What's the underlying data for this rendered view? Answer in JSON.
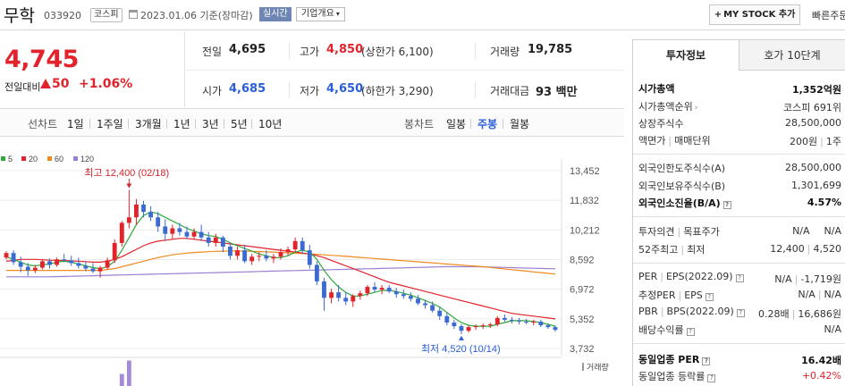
{
  "header": {
    "stock_name": "무학",
    "stock_code": "033920",
    "market_badge": "코스피",
    "date_text": "2023.01.06 기준(장마감)",
    "realtime_label": "실시간",
    "company_btn_label": "기업개요",
    "company_btn_chevron": "▾",
    "mystock_plus": "+",
    "mystock_label": "MY STOCK 추가",
    "quick_link": "빠른주문"
  },
  "price": {
    "current": "4,745",
    "change_label": "전일대비",
    "change_amount": "50",
    "change_rate": "+1.06%"
  },
  "quote": {
    "prev_label": "전일",
    "prev_value": "4,695",
    "high_label": "고가",
    "high_value": "4,850",
    "high_limit": "(상한가 6,100)",
    "volume_label": "거래량",
    "volume_value": "19,785",
    "open_label": "시가",
    "open_value": "4,685",
    "low_label": "저가",
    "low_value": "4,650",
    "low_limit": "(하한가 3,290)",
    "amount_label": "거래대금",
    "amount_value": "93 백만"
  },
  "periods": {
    "line_label": "선차트",
    "line_tabs": [
      "1일",
      "1주일",
      "3개월",
      "1년",
      "3년",
      "5년",
      "10년"
    ],
    "candle_label": "봉차트",
    "candle_tabs": [
      "일봉",
      "주봉",
      "월봉"
    ],
    "candle_selected": 1
  },
  "chart_data": {
    "type": "candlestick",
    "ma_legend": [
      {
        "label": "5",
        "color": "#2fa83a"
      },
      {
        "label": "20",
        "color": "#e2232b"
      },
      {
        "label": "60",
        "color": "#f08a1c"
      },
      {
        "label": "120",
        "color": "#9b7fd0"
      }
    ],
    "y_ticks": [
      "13,452",
      "11,832",
      "10,212",
      "8,592",
      "6,972",
      "5,352",
      "3,732"
    ],
    "y_tick_values": [
      13452,
      11832,
      10212,
      8592,
      6972,
      5352,
      3732
    ],
    "ylim": [
      3732,
      13452
    ],
    "annotation_high": "최고 12,400 (02/18)",
    "annotation_low": "최저 4,520 (10/14)",
    "high_marker": {
      "index": 17,
      "value": 12400
    },
    "low_marker": {
      "index": 63,
      "value": 4520
    },
    "up_color": "#e2232b",
    "down_color": "#3b6bd1",
    "volume_label": "거래량",
    "candles": [
      [
        8700,
        9050,
        8600,
        8950
      ],
      [
        8950,
        9100,
        8300,
        8450
      ],
      [
        8450,
        8750,
        7900,
        8200
      ],
      [
        8200,
        8400,
        7700,
        8000
      ],
      [
        8000,
        8300,
        7850,
        8150
      ],
      [
        8150,
        8600,
        8050,
        8500
      ],
      [
        8500,
        8650,
        8100,
        8300
      ],
      [
        8300,
        8700,
        8200,
        8600
      ],
      [
        8600,
        8900,
        8450,
        8550
      ],
      [
        8550,
        8800,
        8250,
        8400
      ],
      [
        8400,
        8700,
        8100,
        8250
      ],
      [
        8250,
        8500,
        7950,
        8100
      ],
      [
        8100,
        8400,
        7850,
        7950
      ],
      [
        7950,
        8250,
        7600,
        8150
      ],
      [
        8150,
        8700,
        8050,
        8550
      ],
      [
        8550,
        9700,
        8400,
        9500
      ],
      [
        9500,
        10700,
        9300,
        10600
      ],
      [
        10600,
        12400,
        10300,
        10900
      ],
      [
        10900,
        11900,
        10500,
        11600
      ],
      [
        11600,
        11800,
        10900,
        11200
      ],
      [
        11200,
        11500,
        10700,
        10900
      ],
      [
        10900,
        11200,
        10100,
        10400
      ],
      [
        10400,
        10800,
        9600,
        10000
      ],
      [
        10000,
        10500,
        9700,
        10300
      ],
      [
        10300,
        10600,
        9900,
        10100
      ],
      [
        10100,
        10400,
        9700,
        9850
      ],
      [
        9850,
        10300,
        9700,
        10100
      ],
      [
        10100,
        10500,
        9600,
        9800
      ],
      [
        9800,
        10100,
        9300,
        9500
      ],
      [
        9500,
        10000,
        9300,
        9800
      ],
      [
        9800,
        9900,
        9000,
        9300
      ],
      [
        9300,
        9500,
        8600,
        8800
      ],
      [
        8800,
        9300,
        8600,
        9100
      ],
      [
        9100,
        9400,
        8400,
        8500
      ],
      [
        8500,
        8900,
        8300,
        8750
      ],
      [
        8750,
        9000,
        8500,
        8800
      ],
      [
        8800,
        9100,
        8500,
        8650
      ],
      [
        8650,
        8900,
        8400,
        8750
      ],
      [
        8750,
        9200,
        8600,
        9000
      ],
      [
        9000,
        9300,
        8800,
        9150
      ],
      [
        9150,
        9800,
        9000,
        9600
      ],
      [
        9600,
        9800,
        8900,
        9100
      ],
      [
        9100,
        9400,
        8100,
        8300
      ],
      [
        8300,
        8500,
        7200,
        7400
      ],
      [
        7400,
        7600,
        5800,
        6500
      ],
      [
        6500,
        7000,
        6200,
        6800
      ],
      [
        6800,
        7200,
        6300,
        6500
      ],
      [
        6500,
        6800,
        6100,
        6300
      ],
      [
        6300,
        6700,
        6000,
        6600
      ],
      [
        6600,
        6900,
        6400,
        6750
      ],
      [
        6750,
        7200,
        6600,
        7100
      ],
      [
        7100,
        7350,
        6800,
        6950
      ],
      [
        6950,
        7200,
        6700,
        7050
      ],
      [
        7050,
        7200,
        6750,
        6850
      ],
      [
        6850,
        7050,
        6500,
        6700
      ],
      [
        6700,
        6950,
        6450,
        6600
      ],
      [
        6600,
        6800,
        6300,
        6450
      ],
      [
        6450,
        6650,
        6100,
        6200
      ],
      [
        6200,
        6400,
        5900,
        6100
      ],
      [
        6100,
        6300,
        5700,
        5800
      ],
      [
        5800,
        6000,
        5300,
        5500
      ],
      [
        5500,
        5700,
        5000,
        5150
      ],
      [
        5150,
        5300,
        4800,
        4950
      ],
      [
        4950,
        5050,
        4520,
        4700
      ],
      [
        4700,
        5000,
        4600,
        4900
      ],
      [
        4900,
        5050,
        4750,
        4950
      ],
      [
        4950,
        5100,
        4800,
        5000
      ],
      [
        5000,
        5150,
        4850,
        5050
      ],
      [
        5050,
        5500,
        4950,
        5400
      ],
      [
        5400,
        5600,
        5200,
        5300
      ],
      [
        5300,
        5450,
        5100,
        5250
      ],
      [
        5250,
        5400,
        5050,
        5200
      ],
      [
        5200,
        5350,
        5050,
        5150
      ],
      [
        5150,
        5300,
        5000,
        5200
      ],
      [
        5200,
        5300,
        4900,
        5000
      ],
      [
        5000,
        5100,
        4800,
        4900
      ],
      [
        4900,
        5000,
        4650,
        4750
      ]
    ],
    "ma5": [
      8750,
      8600,
      8450,
      8300,
      8250,
      8300,
      8350,
      8450,
      8500,
      8450,
      8350,
      8250,
      8150,
      8100,
      8200,
      8500,
      9100,
      9800,
      10500,
      11000,
      11200,
      11100,
      10900,
      10700,
      10500,
      10300,
      10150,
      10000,
      9900,
      9850,
      9700,
      9500,
      9350,
      9200,
      9050,
      8900,
      8800,
      8700,
      8700,
      8800,
      9000,
      9100,
      9000,
      8600,
      8000,
      7500,
      7100,
      6800,
      6600,
      6600,
      6700,
      6800,
      6900,
      6900,
      6850,
      6750,
      6650,
      6500,
      6350,
      6200,
      6000,
      5700,
      5400,
      5150,
      5000,
      4950,
      4950,
      4950,
      5050,
      5150,
      5250,
      5250,
      5250,
      5200,
      5150,
      5050,
      4950
    ],
    "ma20": [
      8500,
      8550,
      8600,
      8600,
      8600,
      8580,
      8560,
      8550,
      8540,
      8520,
      8500,
      8480,
      8450,
      8450,
      8500,
      8600,
      8750,
      8950,
      9150,
      9350,
      9500,
      9600,
      9650,
      9700,
      9750,
      9750,
      9700,
      9650,
      9600,
      9550,
      9500,
      9450,
      9400,
      9350,
      9300,
      9250,
      9200,
      9150,
      9100,
      9050,
      9000,
      8950,
      8900,
      8800,
      8700,
      8550,
      8400,
      8250,
      8100,
      7950,
      7800,
      7650,
      7500,
      7350,
      7250,
      7150,
      7050,
      6950,
      6850,
      6750,
      6650,
      6550,
      6450,
      6350,
      6250,
      6150,
      6050,
      5950,
      5850,
      5750,
      5650,
      5600,
      5550,
      5500,
      5450,
      5400,
      5350
    ],
    "ma60": [
      8000,
      8000,
      8000,
      8000,
      8000,
      8000,
      8000,
      8000,
      8000,
      8000,
      8000,
      8000,
      8000,
      8000,
      8050,
      8100,
      8200,
      8300,
      8400,
      8500,
      8600,
      8700,
      8780,
      8850,
      8900,
      8950,
      8980,
      9000,
      9020,
      9040,
      9050,
      9060,
      9060,
      9050,
      9040,
      9030,
      9010,
      9000,
      8980,
      8960,
      8940,
      8920,
      8900,
      8880,
      8850,
      8820,
      8800,
      8770,
      8740,
      8710,
      8680,
      8650,
      8620,
      8590,
      8560,
      8530,
      8500,
      8470,
      8440,
      8410,
      8380,
      8350,
      8320,
      8290,
      8260,
      8230,
      8200,
      8160,
      8120,
      8080,
      8040,
      8000,
      7960,
      7920,
      7880,
      7840,
      7800
    ],
    "ma120": [
      7650,
      7650,
      7650,
      7650,
      7650,
      7650,
      7650,
      7660,
      7670,
      7680,
      7690,
      7700,
      7710,
      7720,
      7730,
      7740,
      7750,
      7760,
      7770,
      7780,
      7790,
      7800,
      7810,
      7820,
      7830,
      7840,
      7850,
      7860,
      7870,
      7880,
      7890,
      7900,
      7910,
      7920,
      7930,
      7940,
      7950,
      7960,
      7970,
      7980,
      7990,
      8000,
      8010,
      8020,
      8030,
      8040,
      8050,
      8060,
      8070,
      8080,
      8090,
      8100,
      8110,
      8120,
      8130,
      8140,
      8150,
      8160,
      8170,
      8180,
      8190,
      8200,
      8200,
      8200,
      8200,
      8200,
      8190,
      8180,
      8170,
      8160,
      8150,
      8140,
      8130,
      8120,
      8110,
      8100,
      8090
    ],
    "volume_visible": [
      {
        "index": 17,
        "ratio": 0.95
      },
      {
        "index": 16,
        "ratio": 0.45
      }
    ]
  },
  "right_panel": {
    "tab_invest": "투자정보",
    "tab_hoga": "호가 10단계",
    "market_cap_label": "시가총액",
    "market_cap_value": "1,352억원",
    "cap_rank_label": "시가총액순위",
    "cap_rank_value": "코스피 691위",
    "shares_label": "상장주식수",
    "shares_value": "28,500,000",
    "par_label": "액면가",
    "unit_label": "매매단위",
    "par_value": "200원",
    "unit_value": "1주",
    "foreign_limit_label": "외국인한도주식수(A)",
    "foreign_limit_value": "28,500,000",
    "foreign_hold_label": "외국인보유주식수(B)",
    "foreign_hold_value": "1,301,699",
    "foreign_ratio_label": "외국인소진율(B/A)",
    "foreign_ratio_value": "4.57%",
    "opinion_label": "투자의견",
    "target_label": "목표주가",
    "opinion_value": "N/A",
    "target_value": "N/A",
    "w52_high_label": "52주최고",
    "w52_low_label": "최저",
    "w52_high_value": "12,400",
    "w52_low_value": "4,520",
    "per_label": "PER",
    "eps_label": "EPS(2022.09)",
    "per_value": "N/A",
    "eps_value": "-1,719원",
    "est_per_label": "추정PER",
    "est_eps_label": "EPS",
    "est_per_value": "N/A",
    "est_eps_value": "N/A",
    "pbr_label": "PBR",
    "bps_label": "BPS(2022.09)",
    "pbr_value": "0.28배",
    "bps_value": "16,686원",
    "div_label": "배당수익률",
    "div_value": "N/A",
    "sector_per_label": "동일업종 PER",
    "sector_per_value": "16.42배",
    "sector_rate_label": "동일업종 등락률",
    "sector_rate_value": "+0.42%"
  }
}
